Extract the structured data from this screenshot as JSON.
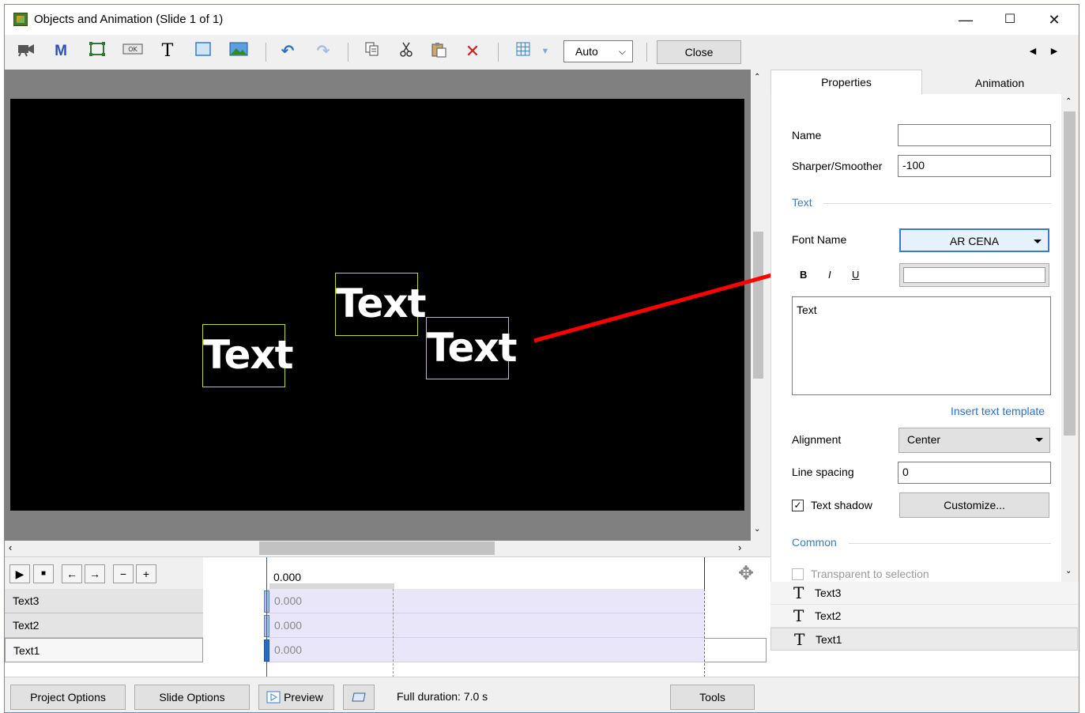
{
  "window": {
    "title": "Objects and Animation (Slide 1 of 1)",
    "minimize": "—",
    "maximize": "☐",
    "close": "✕"
  },
  "toolbar": {
    "zoom_value": "Auto",
    "close_label": "Close",
    "nav_prev": "◀",
    "nav_next": "▶"
  },
  "canvas": {
    "objects": [
      "Text",
      "Text",
      "Text"
    ]
  },
  "tabs": {
    "properties": "Properties",
    "animation": "Animation"
  },
  "properties": {
    "name_label": "Name",
    "name_value": "",
    "sharper_label": "Sharper/Smoother",
    "sharper_value": "-100",
    "text_section": "Text",
    "font_name_label": "Font Name",
    "font_name_value": "AR CENA",
    "bold": "B",
    "italic": "I",
    "underline": "U",
    "text_value": "Text",
    "insert_template": "Insert text template",
    "alignment_label": "Alignment",
    "alignment_value": "Center",
    "line_spacing_label": "Line spacing",
    "line_spacing_value": "0",
    "text_shadow_label": "Text shadow",
    "text_shadow_checked": true,
    "customize_label": "Customize...",
    "common_section": "Common",
    "transparent_label": "Transparent to selection"
  },
  "object_list": [
    {
      "label": "Text3"
    },
    {
      "label": "Text2"
    },
    {
      "label": "Text1"
    }
  ],
  "timeline": {
    "time_value": "0.000",
    "rows": [
      {
        "label": "Text3",
        "value": "0.000"
      },
      {
        "label": "Text2",
        "value": "0.000"
      },
      {
        "label": "Text1",
        "value": "0.000"
      }
    ]
  },
  "bottom": {
    "project_options": "Project Options",
    "slide_options": "Slide Options",
    "preview": "Preview",
    "full_duration": "Full duration: 7.0 s",
    "tools": "Tools"
  },
  "colors": {
    "arrow": "#ff0000",
    "selection_border": "#c5d62a",
    "section_text": "#3b7bbf",
    "track_fill": "#e8e6f8"
  }
}
